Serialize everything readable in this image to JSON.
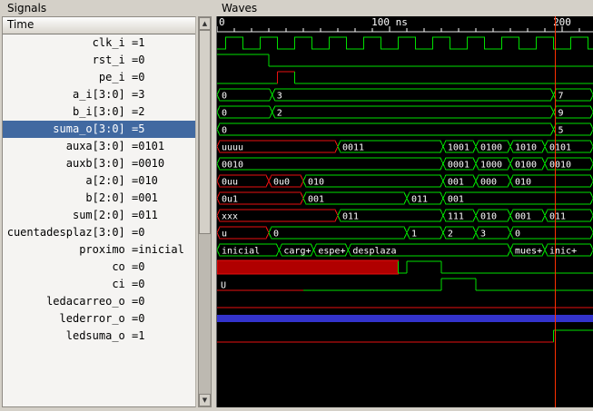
{
  "signals": {
    "title": "Signals",
    "header": "Time",
    "items": [
      {
        "name": "clk_i",
        "value": "1"
      },
      {
        "name": "rst_i",
        "value": "0"
      },
      {
        "name": "pe_i",
        "value": "0"
      },
      {
        "name": "a_i[3:0]",
        "value": "3"
      },
      {
        "name": "b_i[3:0]",
        "value": "2"
      },
      {
        "name": "suma_o[3:0]",
        "value": "5",
        "selected": true
      },
      {
        "name": "auxa[3:0]",
        "value": "0101"
      },
      {
        "name": "auxb[3:0]",
        "value": "0010"
      },
      {
        "name": "a[2:0]",
        "value": "010"
      },
      {
        "name": "b[2:0]",
        "value": "001"
      },
      {
        "name": "sum[2:0]",
        "value": "011"
      },
      {
        "name": "cuentadesplaz[3:0]",
        "value": "0"
      },
      {
        "name": "proximo",
        "value": "inicial"
      },
      {
        "name": "co",
        "value": "0"
      },
      {
        "name": "ci",
        "value": "0"
      },
      {
        "name": "ledacarreo_o",
        "value": "0"
      },
      {
        "name": "lederror_o",
        "value": "0"
      },
      {
        "name": "ledsuma_o",
        "value": "1"
      }
    ]
  },
  "waves": {
    "title": "Waves",
    "timeline": {
      "labels": [
        {
          "t": 0,
          "text": "0"
        },
        {
          "t": 100,
          "text": "100 ns"
        },
        {
          "t": 200,
          "text": "200"
        }
      ],
      "tick_minor_ns": 10,
      "t_end": 218
    },
    "cursor_t": 196,
    "rows": [
      {
        "name": "clk_i",
        "type": "clock",
        "first_rise": 5,
        "half_period": 10
      },
      {
        "name": "rst_i",
        "type": "bit",
        "segs": [
          {
            "t0": 0,
            "t1": 30,
            "v": 1
          },
          {
            "t0": 30,
            "t1": 218,
            "v": 0
          }
        ]
      },
      {
        "name": "pe_i",
        "type": "bit",
        "segs": [
          {
            "t0": 0,
            "t1": 35,
            "v": 0
          },
          {
            "t0": 35,
            "t1": 45,
            "v": 1,
            "c": "r"
          },
          {
            "t0": 45,
            "t1": 218,
            "v": 0
          }
        ]
      },
      {
        "name": "a_i",
        "type": "bus",
        "segs": [
          {
            "t0": 0,
            "t1": 32,
            "label": "0"
          },
          {
            "t0": 32,
            "t1": 195,
            "label": "3"
          },
          {
            "t0": 195,
            "t1": 218,
            "label": "7"
          }
        ]
      },
      {
        "name": "b_i",
        "type": "bus",
        "segs": [
          {
            "t0": 0,
            "t1": 32,
            "label": "0"
          },
          {
            "t0": 32,
            "t1": 195,
            "label": "2"
          },
          {
            "t0": 195,
            "t1": 218,
            "label": "9"
          }
        ]
      },
      {
        "name": "suma_o",
        "type": "bus",
        "segs": [
          {
            "t0": 0,
            "t1": 195,
            "label": "0"
          },
          {
            "t0": 195,
            "t1": 218,
            "label": "5"
          }
        ]
      },
      {
        "name": "auxa",
        "type": "bus",
        "segs": [
          {
            "t0": 0,
            "t1": 70,
            "label": "uuuu",
            "c": "r"
          },
          {
            "t0": 70,
            "t1": 131,
            "label": "0011"
          },
          {
            "t0": 131,
            "t1": 150,
            "label": "1001"
          },
          {
            "t0": 150,
            "t1": 170,
            "label": "0100"
          },
          {
            "t0": 170,
            "t1": 190,
            "label": "1010"
          },
          {
            "t0": 190,
            "t1": 218,
            "label": "0101"
          }
        ]
      },
      {
        "name": "auxb",
        "type": "bus",
        "segs": [
          {
            "t0": 0,
            "t1": 131,
            "label": "0010"
          },
          {
            "t0": 131,
            "t1": 150,
            "label": "0001"
          },
          {
            "t0": 150,
            "t1": 170,
            "label": "1000"
          },
          {
            "t0": 170,
            "t1": 190,
            "label": "0100"
          },
          {
            "t0": 190,
            "t1": 218,
            "label": "0010"
          }
        ]
      },
      {
        "name": "a",
        "type": "bus",
        "segs": [
          {
            "t0": 0,
            "t1": 30,
            "label": "0uu",
            "c": "r"
          },
          {
            "t0": 30,
            "t1": 50,
            "label": "0u0",
            "c": "r"
          },
          {
            "t0": 50,
            "t1": 131,
            "label": "010"
          },
          {
            "t0": 131,
            "t1": 150,
            "label": "001"
          },
          {
            "t0": 150,
            "t1": 170,
            "label": "000"
          },
          {
            "t0": 170,
            "t1": 218,
            "label": "010"
          }
        ]
      },
      {
        "name": "b",
        "type": "bus",
        "segs": [
          {
            "t0": 0,
            "t1": 50,
            "label": "0u1",
            "c": "r"
          },
          {
            "t0": 50,
            "t1": 110,
            "label": "001"
          },
          {
            "t0": 110,
            "t1": 131,
            "label": "011"
          },
          {
            "t0": 131,
            "t1": 218,
            "label": "001"
          }
        ]
      },
      {
        "name": "sum",
        "type": "bus",
        "segs": [
          {
            "t0": 0,
            "t1": 70,
            "label": "xxx",
            "c": "r"
          },
          {
            "t0": 70,
            "t1": 131,
            "label": "011"
          },
          {
            "t0": 131,
            "t1": 150,
            "label": "111"
          },
          {
            "t0": 150,
            "t1": 170,
            "label": "010"
          },
          {
            "t0": 170,
            "t1": 190,
            "label": "001"
          },
          {
            "t0": 190,
            "t1": 218,
            "label": "011"
          }
        ]
      },
      {
        "name": "cuentadesplaz",
        "type": "bus",
        "segs": [
          {
            "t0": 0,
            "t1": 30,
            "label": "u",
            "c": "r"
          },
          {
            "t0": 30,
            "t1": 110,
            "label": "0"
          },
          {
            "t0": 110,
            "t1": 131,
            "label": "1"
          },
          {
            "t0": 131,
            "t1": 150,
            "label": "2"
          },
          {
            "t0": 150,
            "t1": 170,
            "label": "3"
          },
          {
            "t0": 170,
            "t1": 218,
            "label": "0"
          }
        ]
      },
      {
        "name": "proximo",
        "type": "bus",
        "segs": [
          {
            "t0": 0,
            "t1": 36,
            "label": "inicial"
          },
          {
            "t0": 36,
            "t1": 56,
            "label": "carg+"
          },
          {
            "t0": 56,
            "t1": 76,
            "label": "espe+"
          },
          {
            "t0": 76,
            "t1": 170,
            "label": "desplaza"
          },
          {
            "t0": 170,
            "t1": 190,
            "label": "mues+"
          },
          {
            "t0": 190,
            "t1": 218,
            "label": "inic+"
          }
        ]
      },
      {
        "name": "co",
        "type": "bit",
        "segs": [
          {
            "t0": 0,
            "t1": 105,
            "v": "x"
          },
          {
            "t0": 105,
            "t1": 110,
            "v": 0
          },
          {
            "t0": 110,
            "t1": 130,
            "v": 1
          },
          {
            "t0": 130,
            "t1": 218,
            "v": 0
          }
        ]
      },
      {
        "name": "ci",
        "type": "bit",
        "segs": [
          {
            "t0": 0,
            "t1": 50,
            "v": 0,
            "c": "r",
            "label": "U"
          },
          {
            "t0": 50,
            "t1": 130,
            "v": 0
          },
          {
            "t0": 130,
            "t1": 150,
            "v": 1
          },
          {
            "t0": 150,
            "t1": 218,
            "v": 0
          }
        ]
      },
      {
        "name": "ledacarreo_o",
        "type": "bit",
        "segs": [
          {
            "t0": 0,
            "t1": 218,
            "v": 0,
            "c": "r"
          }
        ]
      },
      {
        "name": "lederror_o",
        "type": "band",
        "t0": 0,
        "t1": 218
      },
      {
        "name": "ledsuma_o",
        "type": "bit",
        "segs": [
          {
            "t0": 0,
            "t1": 195,
            "v": 0,
            "c": "r"
          },
          {
            "t0": 195,
            "t1": 218,
            "v": 1
          }
        ]
      }
    ]
  },
  "colors": {
    "wave_green": "#00df00",
    "wave_red": "#e81010",
    "u_fill": "#b00000",
    "band_blue": "#3333cc",
    "cursor": "#ff3000",
    "label_text": "#ffffff",
    "selection_bg": "#4169a1",
    "timeline_text": "#ffffff"
  }
}
